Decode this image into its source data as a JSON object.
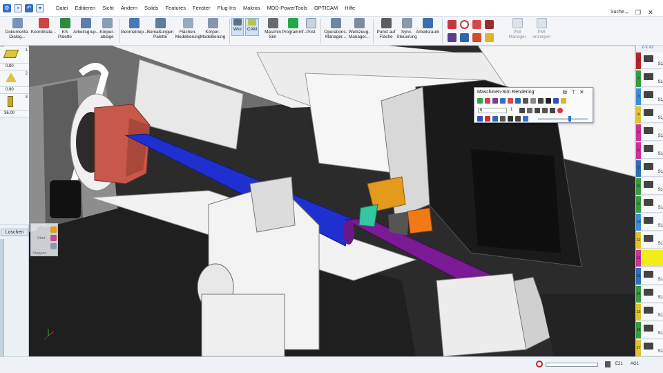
{
  "menubar": {
    "items": [
      "Datei",
      "Editieren",
      "Sicht",
      "Ändern",
      "Solids",
      "Features",
      "Fenster",
      "Plug-Ins",
      "Makros",
      "MDD-PowerTools",
      "OPTICAM",
      "Hilfe"
    ],
    "search_label": "Suche"
  },
  "ribbon": {
    "buttons": [
      {
        "label1": "Dokumente-",
        "label2": "Dialog...",
        "icon": "document-dialog-icon"
      },
      {
        "label1": "Koordinate...",
        "label2": "",
        "icon": "coordinate-icon"
      },
      {
        "label1": "KS Palette",
        "label2": "",
        "icon": "cs-palette-icon"
      },
      {
        "label1": "Arbeitsgrup...",
        "label2": "",
        "icon": "workgroup-icon"
      },
      {
        "label1": "Körper-",
        "label2": "ablage",
        "icon": "solid-storage-icon"
      },
      {
        "label1": "Geometriep...",
        "label2": "",
        "icon": "geometry-palette-icon"
      },
      {
        "label1": "Bemaßungen",
        "label2": "Palette",
        "icon": "dimension-palette-icon"
      },
      {
        "label1": "Flächen-",
        "label2": "Modellierung",
        "icon": "surface-modeling-icon"
      },
      {
        "label1": "Körper-",
        "label2": "Modellierung",
        "icon": "solid-modeling-icon"
      },
      {
        "label1": "Wkz",
        "label2": "",
        "icon": "tool-icon"
      },
      {
        "label1": "CAM",
        "label2": "",
        "icon": "cam-icon"
      },
      {
        "label1": "Maschin",
        "label2": "Sim",
        "icon": "machine-sim-icon"
      },
      {
        "label1": "Programmf...",
        "label2": "",
        "icon": "program-check-icon"
      },
      {
        "label1": "Post",
        "label2": "",
        "icon": "post-icon"
      },
      {
        "label1": "Operations-",
        "label2": "Manager...",
        "icon": "operations-manager-icon"
      },
      {
        "label1": "Werkzeug-",
        "label2": "Manager...",
        "icon": "tool-manager-icon"
      },
      {
        "label1": "Punkt auf",
        "label2": "Fläche",
        "icon": "point-on-surface-icon"
      },
      {
        "label1": "Sync-",
        "label2": "Steuerung",
        "icon": "sync-control-icon"
      },
      {
        "label1": "Arbeitsraum",
        "label2": "",
        "icon": "workspace-icon"
      },
      {
        "label1": "PMI Manager",
        "label2": "",
        "icon": "pmi-manager-icon"
      },
      {
        "label1": "PMI anzeigen",
        "label2": "",
        "icon": "pmi-show-icon"
      }
    ]
  },
  "left_panel": {
    "values": [
      "0.80",
      "0.80",
      "36.00"
    ],
    "row_numbers": [
      "1",
      "2",
      "3"
    ],
    "delete_button": "Loschen",
    "mini_start": "Start",
    "mini_stop": "Stoppen"
  },
  "sim_dialog": {
    "title": "Maschinen-Sim Rendering",
    "field_value": "6",
    "step_value": "1"
  },
  "right_panel": {
    "tabs": [
      "1",
      "2",
      "3",
      "4",
      "5",
      "6",
      "7",
      "8",
      "9",
      "10",
      "11",
      "12",
      "13",
      "14",
      "15",
      "16",
      "17"
    ],
    "cell_label": "S1",
    "top_badges": [
      "Z-X",
      "XZ"
    ]
  },
  "status": {
    "e_label": "E21",
    "a_label": "AG1"
  },
  "colors": {
    "shaft_blue": "#1f2fd0",
    "shaft_purple": "#7a1a94",
    "chuck_red": "#c8584a",
    "tool_orange": "#e39a1d",
    "tool_teal": "#34c7a0"
  }
}
